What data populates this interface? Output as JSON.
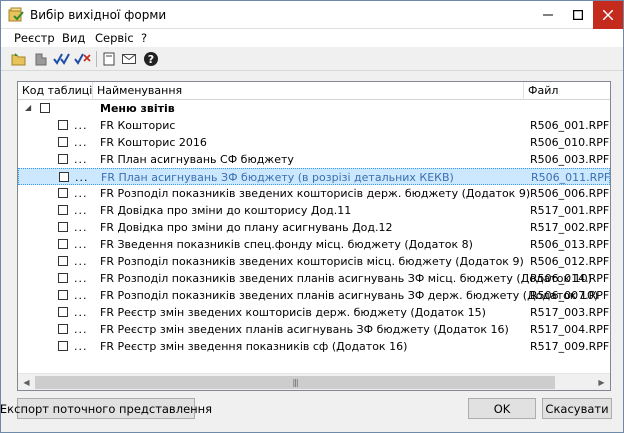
{
  "window": {
    "title": "Вибір вихідної форми",
    "controls": {
      "minimize": "—",
      "maximize": "☐",
      "close": "✕"
    }
  },
  "menu": [
    "Реєстр",
    "Вид",
    "Сервіс",
    "?"
  ],
  "toolbar": {
    "icons": [
      "open-folder-icon",
      "tool-icon",
      "check-all-icon",
      "uncheck-all-icon",
      "document-icon",
      "mail-icon",
      "help-icon"
    ]
  },
  "grid": {
    "columns": [
      "Код таблиці",
      "Найменування",
      "Файл"
    ],
    "group": {
      "name": "Меню звітів"
    },
    "rows": [
      {
        "dots": "...",
        "name": "FR Кошторис",
        "file": "R506_001.RPF"
      },
      {
        "dots": "...",
        "name": "FR Кошторис 2016",
        "file": "R506_010.RPF"
      },
      {
        "dots": "...",
        "name": "FR План асигнувань СФ бюджету",
        "file": "R506_003.RPF"
      },
      {
        "dots": "...",
        "name": "FR План асигнувань ЗФ бюджету (в розрізі детальних КЕКВ)",
        "file": "R506_011.RPF",
        "selected": true
      },
      {
        "dots": "...",
        "name": "FR Розподіл показників зведених кошторисів держ. бюджету (Додаток 9)",
        "file": "R506_006.RPF"
      },
      {
        "dots": "...",
        "name": "FR Довідка про зміни до кошторису Дод.11",
        "file": "R517_001.RPF"
      },
      {
        "dots": "...",
        "name": "FR Довідка про зміни до плану асигнувань Дод.12",
        "file": "R517_002.RPF"
      },
      {
        "dots": "...",
        "name": "FR Зведення показників спец.фонду місц. бюджету (Додаток 8)",
        "file": "R506_013.RPF"
      },
      {
        "dots": "...",
        "name": "FR Розподіл показників зведених кошторисів місц. бюджету (Додаток 9)",
        "file": "R506_012.RPF"
      },
      {
        "dots": "...",
        "name": "FR Розподіл показників зведених планів асигнувань ЗФ місц. бюджету (Додаток 10)",
        "file": "R506_014.RPF"
      },
      {
        "dots": "...",
        "name": "FR Розподіл показників зведених планів асигнувань ЗФ держ. бюджету (Додаток 10)",
        "file": "R506_007.RPF"
      },
      {
        "dots": "...",
        "name": "FR Реєстр змін зведених кошторисів держ. бюджету (Додаток 15)",
        "file": "R517_003.RPF"
      },
      {
        "dots": "...",
        "name": "FR Реєстр змін зведених планів асигнувань ЗФ бюджету (Додаток 16)",
        "file": "R517_004.RPF"
      },
      {
        "dots": "...",
        "name": "FR Реєстр змін зведення показників сф (Додаток 16)",
        "file": "R517_009.RPF"
      }
    ],
    "scroll_thumb_glyph": "|||"
  },
  "buttons": {
    "export": "Експорт поточного представлення",
    "ok": "OK",
    "cancel": "Скасувати"
  },
  "colors": {
    "selection_bg": "#cce8ff",
    "selection_border": "#3399ff",
    "selected_text": "#3a6fb0",
    "close_button": "#c42b1c"
  }
}
